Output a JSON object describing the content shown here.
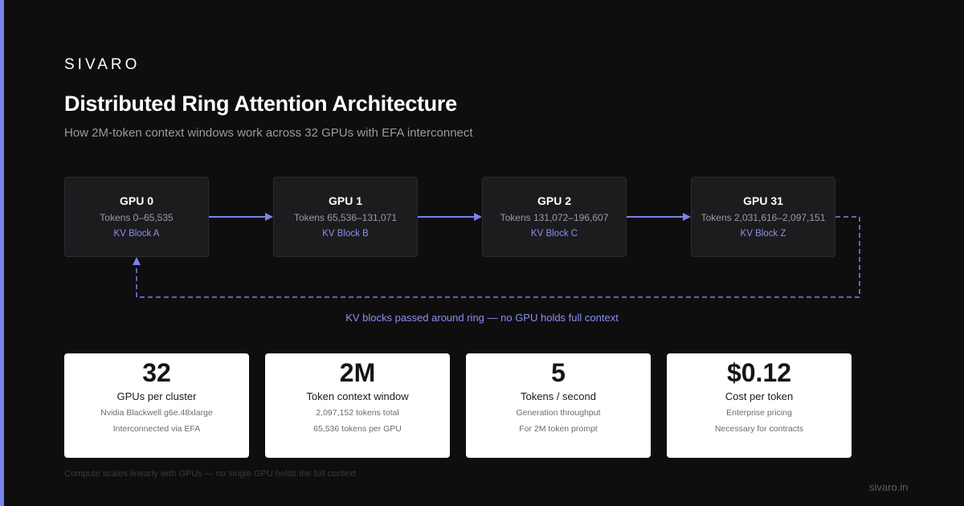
{
  "brand": "SIVARO",
  "title": "Distributed Ring Attention Architecture",
  "subtitle": "How 2M-token context windows work across 32 GPUs with EFA interconnect",
  "gpus": [
    {
      "name": "GPU 0",
      "tokens": "Tokens 0–65,535",
      "kv": "KV Block A"
    },
    {
      "name": "GPU 1",
      "tokens": "Tokens 65,536–131,071",
      "kv": "KV Block B"
    },
    {
      "name": "GPU 2",
      "tokens": "Tokens 131,072–196,607",
      "kv": "KV Block C"
    },
    {
      "name": "GPU 31",
      "tokens": "Tokens 2,031,616–2,097,151",
      "kv": "KV Block Z"
    }
  ],
  "ring_caption": "KV blocks passed around ring — no GPU holds full context",
  "stats": [
    {
      "value": "32",
      "label": "GPUs per cluster",
      "sub1": "Nvidia Blackwell g6e.48xlarge",
      "sub2": "Interconnected via EFA"
    },
    {
      "value": "2M",
      "label": "Token context window",
      "sub1": "2,097,152 tokens total",
      "sub2": "65,536 tokens per GPU"
    },
    {
      "value": "5",
      "label": "Tokens / second",
      "sub1": "Generation throughput",
      "sub2": "For 2M token prompt"
    },
    {
      "value": "$0.12",
      "label": "Cost per token",
      "sub1": "Enterprise pricing",
      "sub2": "Necessary for contracts"
    }
  ],
  "footnote": "Compute scales linearly with GPUs — no single GPU holds the full context",
  "site": "sivaro.in",
  "colors": {
    "background": "#0e0e0f",
    "accent": "#7b83ea",
    "card": "#1c1c1f",
    "stat_card": "#ffffff"
  }
}
